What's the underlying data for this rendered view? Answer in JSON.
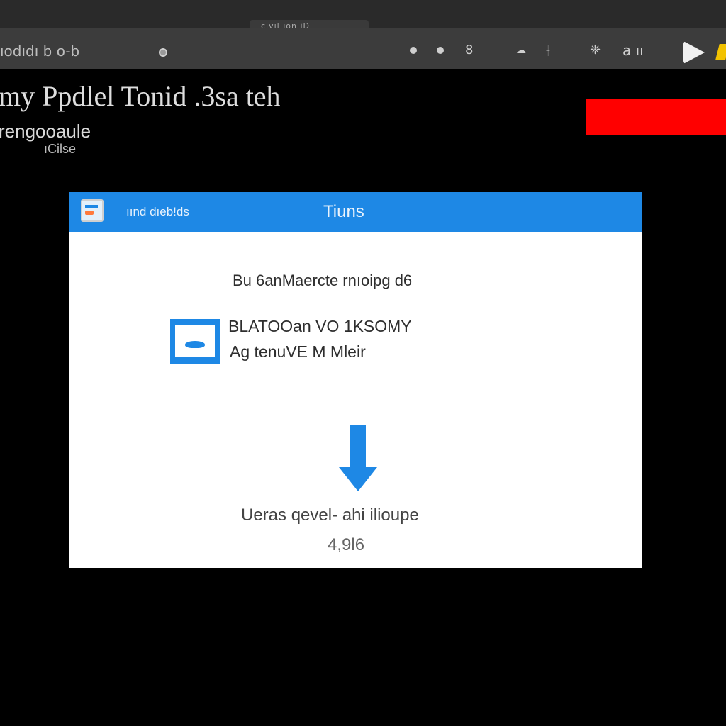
{
  "window": {
    "tab_label": "cıvıl ıon iD"
  },
  "toolbar": {
    "address": "ıodıdı b o-b",
    "icons": [
      "dot-icon",
      "dot-icon",
      "dot-icon",
      "stack-icon",
      "cloud-icon",
      "chart-icon",
      "puzzle-icon",
      "a-icon",
      "play-icon",
      "pen-icon"
    ],
    "icon_glyph_stack": "8",
    "icon_glyph_cloud": "☁",
    "icon_glyph_chart": "⫲",
    "icon_glyph_puzzle": "❈",
    "icon_glyph_label": "a ıı"
  },
  "page": {
    "heading": "my Ppdlel Tonid .3sa teh",
    "subheading": "rengooaule",
    "caption": "ıCilse"
  },
  "dialog": {
    "header_left": "ıınd dıeb!ds",
    "header_title": "Tiuns",
    "line1": "Bu 6anMaercte rnıoipg d6",
    "file_line1": "BLATOOan VO 1KSOMY",
    "file_line2": "Ag tenuVE M Mleir",
    "status": "Ueras qevel- ahi ilioupe",
    "size": "4,9l6"
  },
  "colors": {
    "accent": "#1e88e5",
    "alert": "#ff0000",
    "background": "#000000",
    "toolbar": "#3c3c3c",
    "titlebar": "#2a2a2a",
    "yellow": "#f2c200"
  }
}
